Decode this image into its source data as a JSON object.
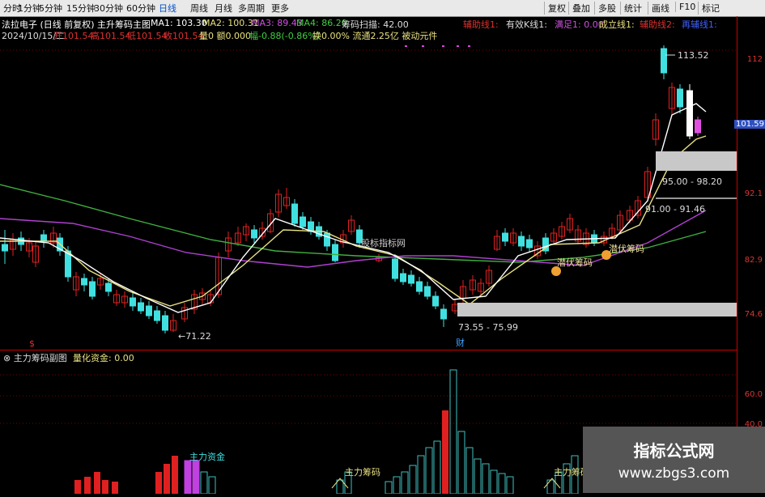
{
  "toolbar": {
    "left": [
      "分时",
      "1分钟",
      "5分钟",
      "15分钟",
      "30分钟",
      "60分钟",
      "日线",
      "周线",
      "月线",
      "多周期",
      "更多"
    ],
    "right": [
      "复权",
      "叠加",
      "多股",
      "统计",
      "画线",
      "F10",
      "标记"
    ]
  },
  "header": {
    "stock": "法拉电子 (日线 前复权)",
    "indicator": "主升筹码主图",
    "ma1": "MA1: 103.30",
    "ma2": "MA2: 100.31",
    "ma3": "MA3: 89.43",
    "ma4": "MA4: 86.20",
    "chip_scan": "筹码扫描: 42.00",
    "date": "2024/10/15/二",
    "open": "开101.54",
    "high": "高101.54",
    "low": "低101.54",
    "close": "收101.54",
    "vol": "量0 额0.000",
    "change": "幅-0.88(-0.86%)",
    "turn": "换0.00% 流通2.25亿 被动元件",
    "tags": [
      "辅助线1:",
      "有效K线1:",
      "满足1: 0.00",
      "成立线1:",
      "辅助线2:",
      "再辅线1:"
    ]
  },
  "annotations": {
    "high_label": "113.52",
    "low_label": "71.22",
    "range1": "73.55 - 75.99",
    "range2": "91.00 - 91.46",
    "range3": "95.00 - 98.20",
    "mark_s": "$",
    "mark_cai": "财",
    "latent1": "潜伏筹码",
    "latent2": "潜伏筹码",
    "watermark_inline": "股标指标网"
  },
  "axis": {
    "main": [
      "112",
      "101.59",
      "92.1",
      "82.9",
      "74.6"
    ],
    "sub": [
      "60.0",
      "40.0"
    ]
  },
  "sub": {
    "title": "主力筹码副图",
    "value": "量化资金: 0.00",
    "label1": "主力资金",
    "label2": "主力筹码",
    "label3": "主力筹码"
  },
  "watermark": {
    "title": "指标公式网",
    "url": "www.zbgs3.com"
  },
  "colors": {
    "up": "#e02020",
    "down": "#40e0e0",
    "ma_white": "#ffffff",
    "ma_yellow": "#e8e080",
    "ma_purple": "#b040d0",
    "ma_green": "#40b040",
    "zone": "#c8c8c8"
  }
}
